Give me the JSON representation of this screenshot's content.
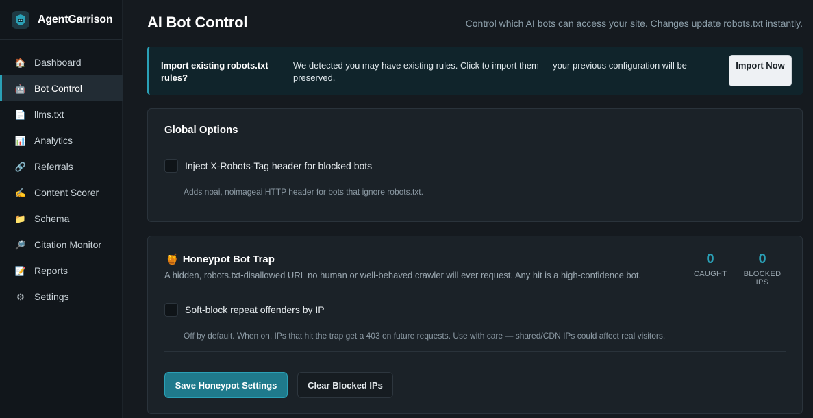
{
  "brand": {
    "name": "AgentGarrison",
    "logo_icon": "shield-robot-icon"
  },
  "sidebar": {
    "items": [
      {
        "label": "Dashboard",
        "icon": "house-icon",
        "active": false
      },
      {
        "label": "Bot Control",
        "icon": "robot-icon",
        "active": true
      },
      {
        "label": "llms.txt",
        "icon": "page-icon",
        "active": false
      },
      {
        "label": "Analytics",
        "icon": "bar-chart-icon",
        "active": false
      },
      {
        "label": "Referrals",
        "icon": "link-icon",
        "active": false
      },
      {
        "label": "Content Scorer",
        "icon": "writing-hand-icon",
        "active": false
      },
      {
        "label": "Schema",
        "icon": "folder-icon",
        "active": false
      },
      {
        "label": "Citation Monitor",
        "icon": "magnifier-icon",
        "active": false
      },
      {
        "label": "Reports",
        "icon": "report-icon",
        "active": false
      },
      {
        "label": "Settings",
        "icon": "gear-icon",
        "active": false
      }
    ]
  },
  "header": {
    "title": "AI Bot Control",
    "subtitle": "Control which AI bots can access your site. Changes update robots.txt instantly."
  },
  "banner": {
    "title": "Import existing robots.txt rules?",
    "text": "We detected you may have existing rules. Click to import them — your previous configuration will be preserved.",
    "button_label": "Import Now"
  },
  "global_options": {
    "title": "Global Options",
    "checkbox_label": "Inject X-Robots-Tag header for blocked bots",
    "checked": false,
    "help": "Adds noai, noimageai HTTP header for bots that ignore robots.txt."
  },
  "honeypot": {
    "title": "Honeypot Bot Trap",
    "title_icon": "honey-pot-icon",
    "description": "A hidden, robots.txt-disallowed URL no human or well-behaved crawler will ever request. Any hit is a high-confidence bot.",
    "stats": [
      {
        "value": "0",
        "label": "CAUGHT"
      },
      {
        "value": "0",
        "label": "BLOCKED IPS"
      }
    ],
    "checkbox_label": "Soft-block repeat offenders by IP",
    "checked": false,
    "help": "Off by default. When on, IPs that hit the trap get a 403 on future requests. Use with care — shared/CDN IPs could affect real visitors.",
    "save_label": "Save Honeypot Settings",
    "clear_label": "Clear Blocked IPs"
  },
  "colors": {
    "accent": "#2aa0b6",
    "background": "#151a1f",
    "sidebar": "#11161b",
    "card": "#1b2228"
  }
}
